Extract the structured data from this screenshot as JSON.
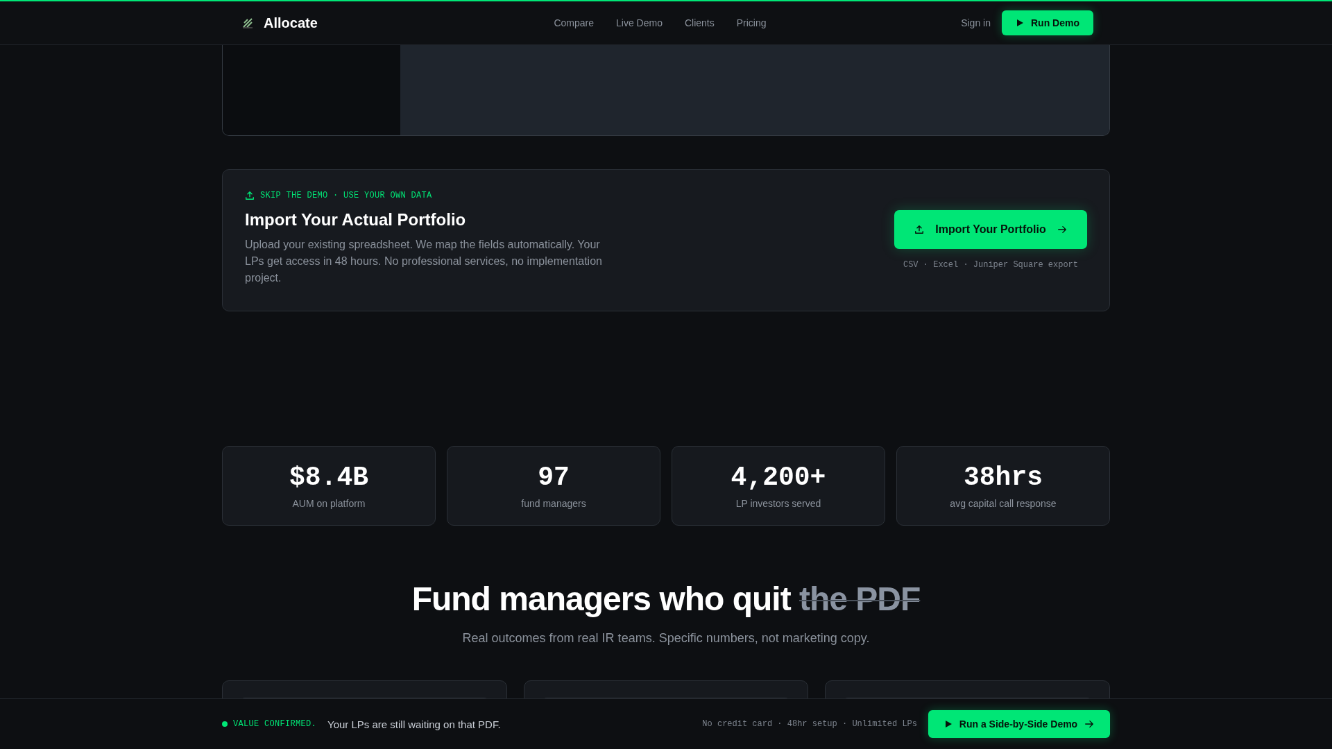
{
  "nav": {
    "brand": "Allocate",
    "links": [
      "Compare",
      "Live Demo",
      "Clients",
      "Pricing"
    ],
    "sign_in": "Sign in",
    "cta": "Run Demo"
  },
  "import_card": {
    "eyebrow": "SKIP THE DEMO · USE YOUR OWN DATA",
    "title": "Import Your Actual Portfolio",
    "description": "Upload your existing spreadsheet. We map the fields automatically. Your LPs get access in 48 hours. No professional services, no implementation project.",
    "button": "Import Your Portfolio",
    "formats": "CSV · Excel · Juniper Square export"
  },
  "stats": [
    {
      "value": "$8.4B",
      "label": "AUM on platform"
    },
    {
      "value": "97",
      "label": "fund managers"
    },
    {
      "value": "4,200+",
      "label": "LP investors served"
    },
    {
      "value": "38hrs",
      "label": "avg capital call response"
    }
  ],
  "testimonials": {
    "heading": "Fund managers who quit",
    "struck": "the PDF",
    "subtitle": "Real outcomes from real IR teams. Specific numbers, not marketing copy."
  },
  "bottom_bar": {
    "status": "VALUE CONFIRMED.",
    "message": "Your LPs are still waiting on that PDF.",
    "notes": "No credit card · 48hr setup · Unlimited LPs",
    "button": "Run a Side-by-Side Demo"
  }
}
